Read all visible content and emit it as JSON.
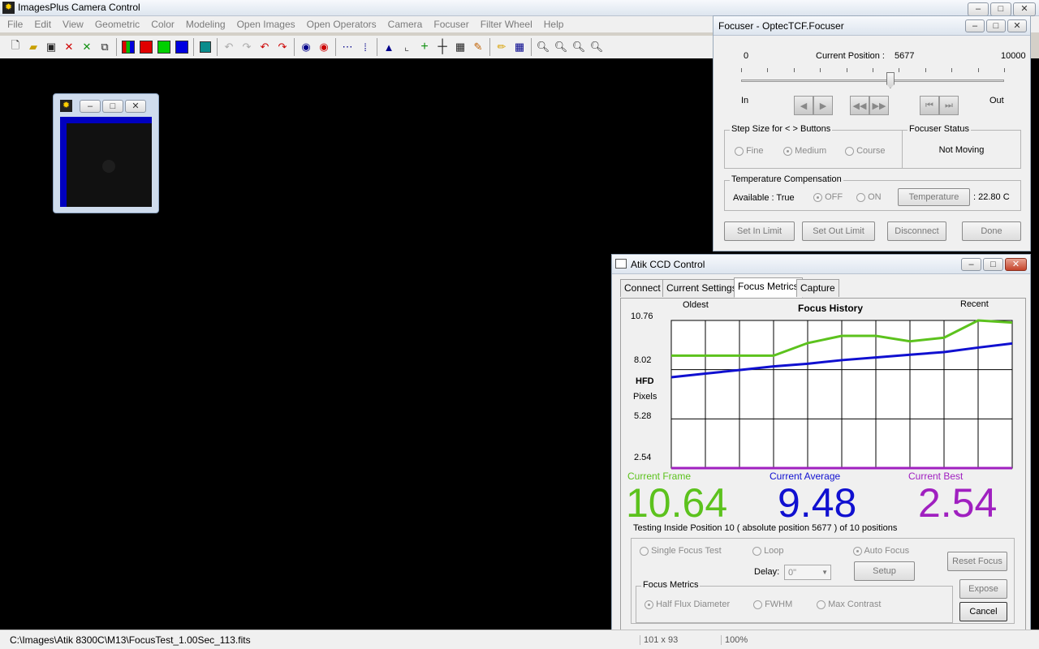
{
  "app": {
    "title": "ImagesPlus Camera Control",
    "menu": [
      "File",
      "Edit",
      "View",
      "Geometric",
      "Color",
      "Modeling",
      "Open Images",
      "Open Operators",
      "Camera",
      "Focuser",
      "Filter Wheel",
      "Help"
    ],
    "status_path": "C:\\Images\\Atik 8300C\\M13\\FocusTest_1.00Sec_113.fits",
    "status_seg2": "101 x 93",
    "status_seg3": "100%"
  },
  "focuser": {
    "title": "Focuser - OptecTCF.Focuser",
    "min": "0",
    "max": "10000",
    "position_label": "Current Position :",
    "position_value": "5677",
    "position": 5677,
    "position_max": 10000,
    "in_label": "In",
    "out_label": "Out",
    "step_group": "Step Size for < > Buttons",
    "step_options": [
      "Fine",
      "Medium",
      "Course"
    ],
    "step_selected": "Medium",
    "status_group": "Focuser Status",
    "status_value": "Not Moving",
    "temp_group": "Temperature Compensation",
    "available": "Available : True",
    "temp_off": "OFF",
    "temp_on": "ON",
    "temp_button": "Temperature",
    "temp_value": ": 22.80 C",
    "buttons": {
      "set_in": "Set In Limit",
      "set_out": "Set Out Limit",
      "disconnect": "Disconnect",
      "done": "Done"
    }
  },
  "ccd": {
    "title": "Atik CCD Control",
    "tabs": [
      "Connect",
      "Current Settings",
      "Focus Metrics",
      "Capture"
    ],
    "active_tab": "Focus Metrics",
    "chart_title": "Focus History",
    "oldest": "Oldest",
    "recent": "Recent",
    "ylabel": "HFD",
    "yunit": "Pixels",
    "current_frame_label": "Current Frame",
    "current_average_label": "Current Average",
    "current_best_label": "Current Best",
    "current_frame": "10.64",
    "current_average": "9.48",
    "current_best": "2.54",
    "testing_text": "Testing Inside Position 10 ( absolute position 5677 ) of 10 positions",
    "single_focus": "Single Focus Test",
    "loop": "Loop",
    "auto_focus": "Auto Focus",
    "reset_focus": "Reset Focus",
    "delay_label": "Delay:",
    "delay_value": "0\"",
    "setup": "Setup",
    "metrics_group": "Focus Metrics",
    "metric_options": [
      "Half Flux Diameter",
      "FWHM",
      "Max Contrast"
    ],
    "metric_selected": "Half Flux Diameter",
    "expose": "Expose",
    "cancel": "Cancel"
  },
  "chart_data": {
    "type": "line",
    "title": "Focus History",
    "xlabel": "",
    "ylabel": "HFD Pixels",
    "yticks": [
      "10.76",
      "8.02",
      "5.28",
      "2.54"
    ],
    "ylim": [
      2.54,
      10.76
    ],
    "x": [
      0,
      1,
      2,
      3,
      4,
      5,
      6,
      7,
      8,
      9,
      10
    ],
    "series": [
      {
        "name": "Current Frame",
        "color": "#5cc21d",
        "values": [
          8.8,
          8.8,
          8.8,
          8.8,
          9.5,
          9.9,
          9.9,
          9.6,
          9.8,
          10.76,
          10.64
        ]
      },
      {
        "name": "Current Average",
        "color": "#1010d0",
        "values": [
          7.6,
          7.8,
          8.0,
          8.2,
          8.35,
          8.55,
          8.7,
          8.85,
          9.0,
          9.25,
          9.48
        ]
      },
      {
        "name": "Current Best",
        "color": "#a020c0",
        "values": [
          2.54,
          2.54,
          2.54,
          2.54,
          2.54,
          2.54,
          2.54,
          2.54,
          2.54,
          2.54,
          2.54
        ]
      }
    ],
    "grid": true,
    "legend": "none"
  },
  "colors": {
    "frame": "#5cc21d",
    "average": "#1010d0",
    "best": "#a020c0"
  }
}
